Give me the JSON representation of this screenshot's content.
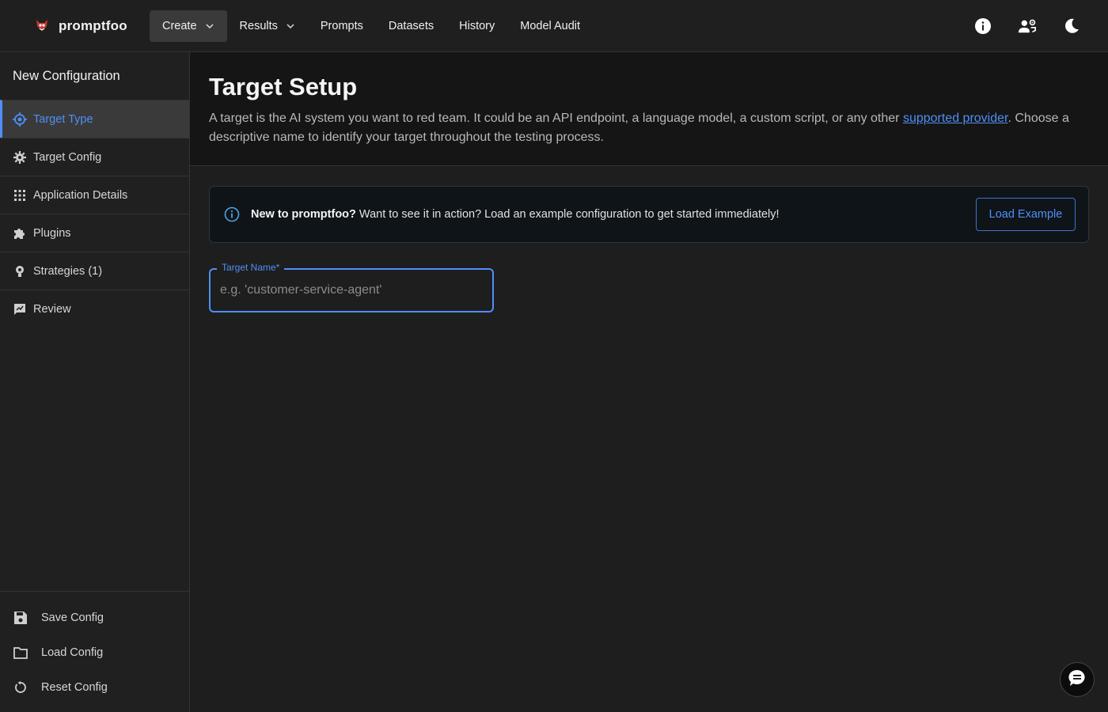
{
  "brand": {
    "name": "promptfoo",
    "logo_icon": "promptfoo-logo-icon"
  },
  "nav": {
    "items": [
      {
        "label": "Create",
        "has_dropdown": true,
        "active": true
      },
      {
        "label": "Results",
        "has_dropdown": true,
        "active": false
      },
      {
        "label": "Prompts",
        "has_dropdown": false,
        "active": false
      },
      {
        "label": "Datasets",
        "has_dropdown": false,
        "active": false
      },
      {
        "label": "History",
        "has_dropdown": false,
        "active": false
      },
      {
        "label": "Model Audit",
        "has_dropdown": false,
        "active": false
      }
    ],
    "right_icons": [
      "info-icon",
      "team-settings-icon",
      "dark-mode-icon"
    ]
  },
  "sidebar": {
    "title": "New Configuration",
    "steps": [
      {
        "label": "Target Type",
        "icon": "target-icon",
        "active": true
      },
      {
        "label": "Target Config",
        "icon": "gear-icon",
        "active": false
      },
      {
        "label": "Application Details",
        "icon": "grid-icon",
        "active": false
      },
      {
        "label": "Plugins",
        "icon": "puzzle-icon",
        "active": false
      },
      {
        "label": "Strategies (1)",
        "icon": "strategy-icon",
        "active": false
      },
      {
        "label": "Review",
        "icon": "review-icon",
        "active": false
      }
    ],
    "actions": [
      {
        "label": "Save Config",
        "icon": "save-icon"
      },
      {
        "label": "Load Config",
        "icon": "folder-icon"
      },
      {
        "label": "Reset Config",
        "icon": "reset-icon"
      }
    ]
  },
  "header": {
    "title": "Target Setup",
    "description_before": "A target is the AI system you want to red team. It could be an API endpoint, a language model, a custom script, or any other ",
    "link_text": "supported provider",
    "description_after": ". Choose a descriptive name to identify your target throughout the testing process."
  },
  "alert": {
    "strong": "New to promptfoo?",
    "text": " Want to see it in action? Load an example configuration to get started immediately!",
    "button": "Load Example"
  },
  "target_name": {
    "label": "Target Name",
    "required_marker": "*",
    "placeholder": "e.g. 'customer-service-agent'",
    "value": ""
  },
  "colors": {
    "accent": "#4f8ff7",
    "background": "#1e1e1e",
    "header_bg": "#151515",
    "alert_bg": "#0f1419"
  }
}
